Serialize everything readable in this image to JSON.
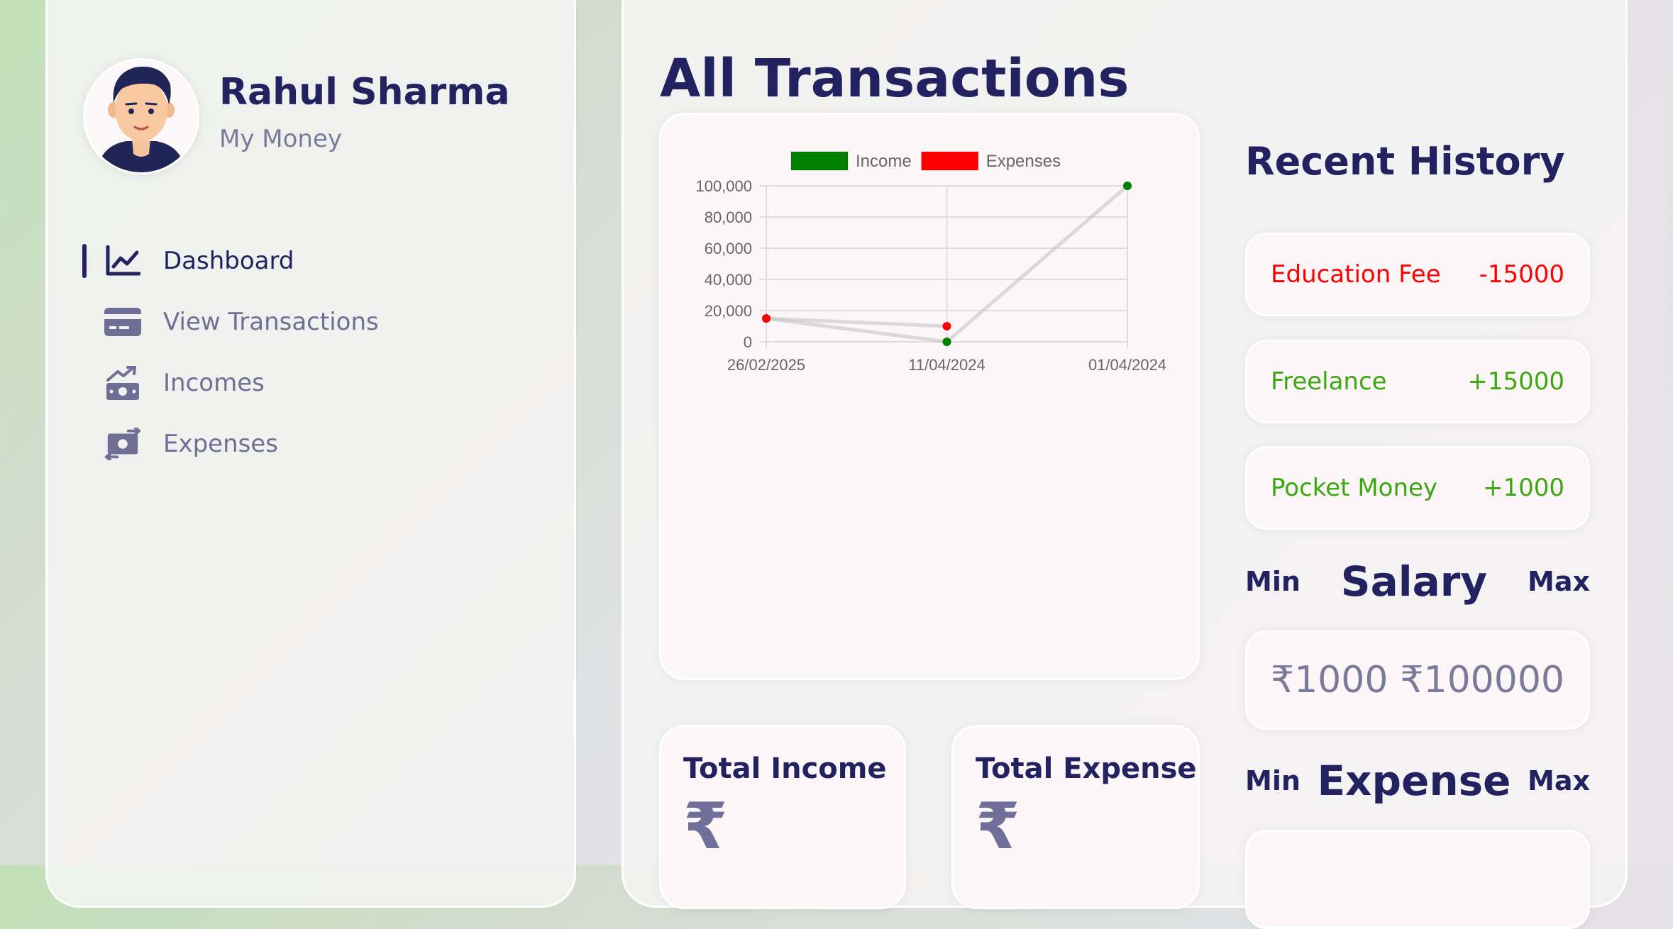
{
  "user": {
    "name": "Rahul Sharma",
    "subtitle": "My Money"
  },
  "nav": {
    "items": [
      {
        "label": "Dashboard",
        "icon": "chart-line-icon",
        "active": true
      },
      {
        "label": "View Transactions",
        "icon": "credit-card-icon",
        "active": false
      },
      {
        "label": "Incomes",
        "icon": "money-bill-trend-up-icon",
        "active": false
      },
      {
        "label": "Expenses",
        "icon": "money-bill-transfer-icon",
        "active": false
      }
    ]
  },
  "page": {
    "title": "All Transactions"
  },
  "chart_data": {
    "type": "line",
    "x": [
      "26/02/2025",
      "11/04/2024",
      "01/04/2024"
    ],
    "series": [
      {
        "name": "Income",
        "color": "#008000",
        "values": [
          15000,
          0,
          100000
        ]
      },
      {
        "name": "Expenses",
        "color": "#ff0000",
        "values": [
          15000,
          10000,
          null
        ]
      }
    ],
    "ylim": [
      0,
      100000
    ],
    "yticks": [
      "100,000",
      "80,000",
      "60,000",
      "40,000",
      "20,000",
      "0"
    ],
    "legend": "top",
    "grid": true
  },
  "totals": {
    "income_label": "Total Income",
    "expense_label": "Total Expense",
    "currency_symbol": "₹"
  },
  "history": {
    "title": "Recent History",
    "items": [
      {
        "label": "Education Fee",
        "amount": "-15000",
        "color": "#ff0000"
      },
      {
        "label": "Freelance",
        "amount": "+15000",
        "color": "#3aa80e"
      },
      {
        "label": "Pocket Money",
        "amount": "+1000",
        "color": "#3aa80e"
      }
    ]
  },
  "salary": {
    "min_label": "Min",
    "title": "Salary",
    "max_label": "Max",
    "min_value": "₹1000",
    "max_value": "₹100000"
  },
  "expense_range": {
    "min_label": "Min",
    "title": "Expense",
    "max_label": "Max"
  }
}
